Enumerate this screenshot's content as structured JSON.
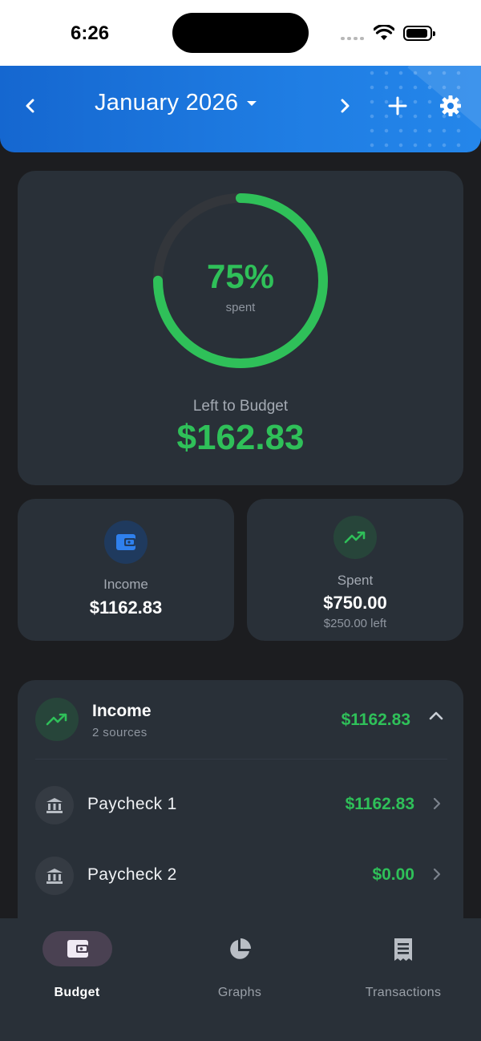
{
  "status_bar": {
    "time": "6:26"
  },
  "header": {
    "month": "January 2026",
    "prev_icon": "chevron-left-icon",
    "next_icon": "chevron-right-icon",
    "add_icon": "plus-icon",
    "settings_icon": "gear-icon"
  },
  "summary": {
    "percent_spent": 0.75,
    "percent_label": "75%",
    "percent_sub": "spent",
    "left_label": "Left to Budget",
    "left_value": "$162.83",
    "accent_color": "#2fc059"
  },
  "income_card": {
    "icon": "wallet-icon",
    "label": "Income",
    "value": "$1162.83"
  },
  "spent_card": {
    "icon": "trending-up-icon",
    "label": "Spent",
    "value": "$750.00",
    "sub": "$250.00 left"
  },
  "income_section": {
    "icon": "trending-up-icon",
    "title": "Income",
    "subtitle": "2 sources",
    "total": "$1162.83",
    "items": [
      {
        "icon": "bank-icon",
        "name": "Paycheck 1",
        "amount": "$1162.83"
      },
      {
        "icon": "bank-icon",
        "name": "Paycheck 2",
        "amount": "$0.00"
      }
    ]
  },
  "nav": {
    "items": [
      {
        "label": "Budget",
        "icon": "wallet-icon",
        "active": true
      },
      {
        "label": "Graphs",
        "icon": "pie-chart-icon",
        "active": false
      },
      {
        "label": "Transactions",
        "icon": "receipt-icon",
        "active": false
      }
    ]
  }
}
